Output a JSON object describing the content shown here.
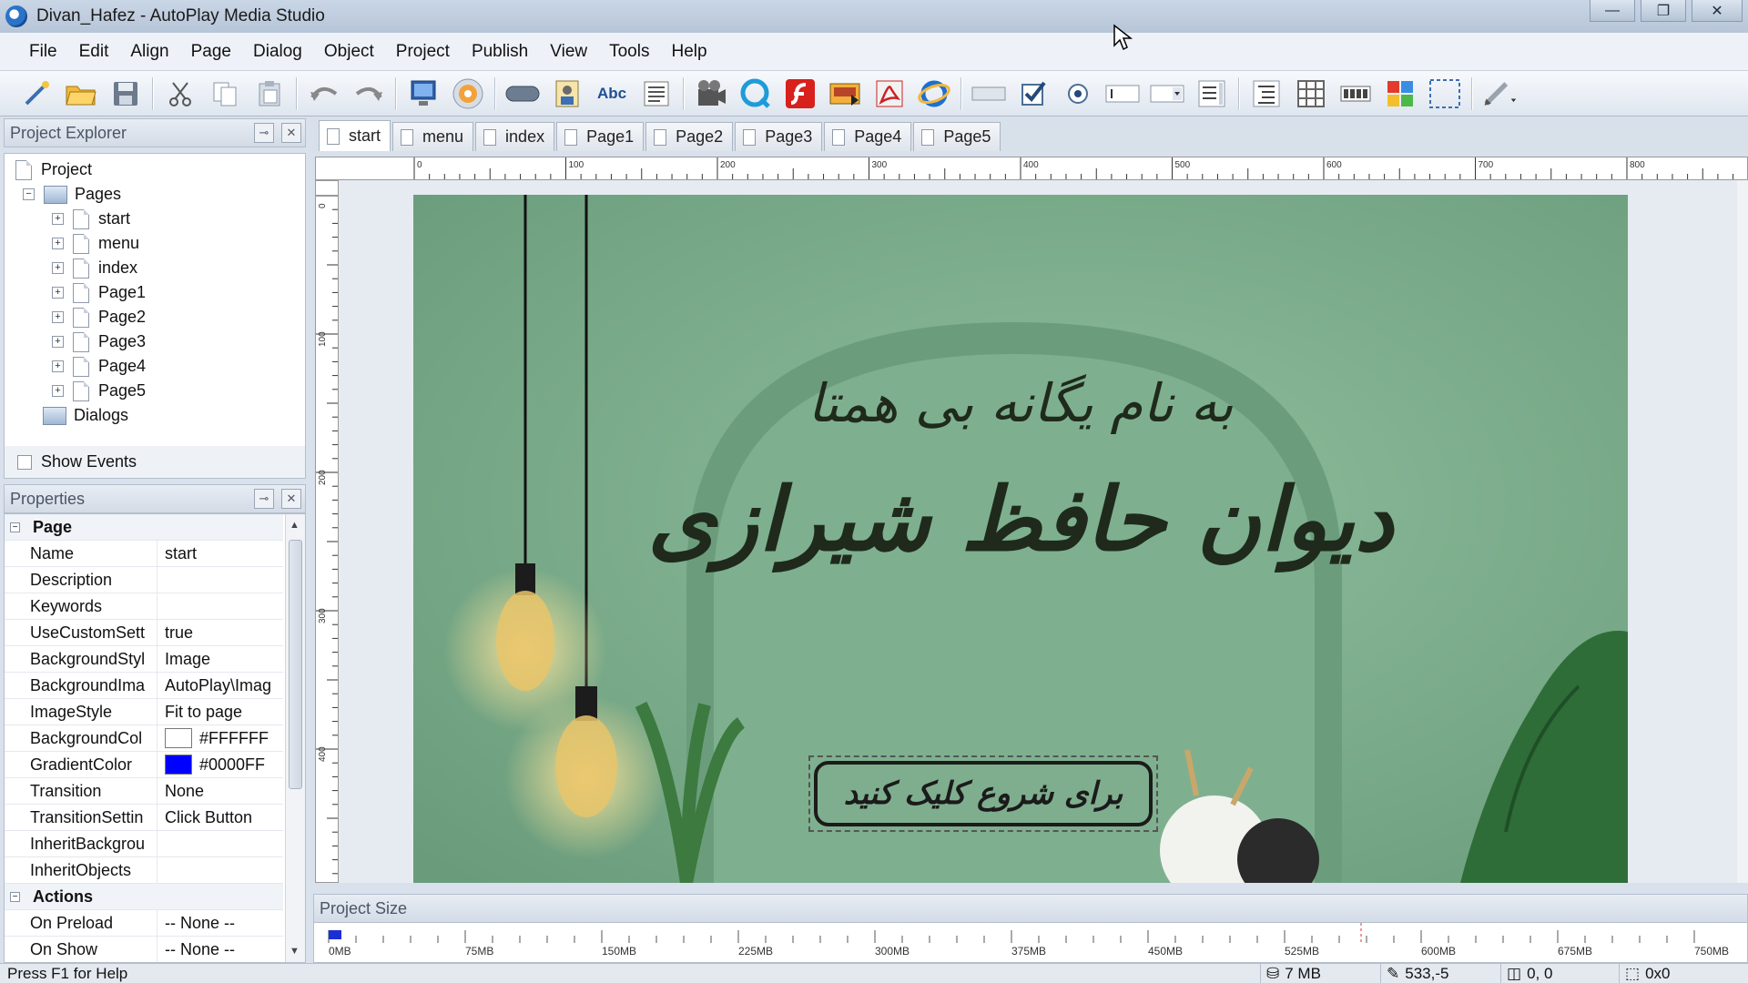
{
  "window": {
    "title": "Divan_Hafez - AutoPlay Media Studio"
  },
  "menu": [
    "File",
    "Edit",
    "Align",
    "Page",
    "Dialog",
    "Object",
    "Project",
    "Publish",
    "View",
    "Tools",
    "Help"
  ],
  "toolbar_icons": [
    "wand-icon",
    "open-folder-icon",
    "save-icon",
    "cut-icon",
    "copy-icon",
    "paste-icon",
    "undo-icon",
    "redo-icon",
    "preview-icon",
    "publish-disc-icon",
    "button-object-icon",
    "image-object-icon",
    "label-object-icon",
    "paragraph-object-icon",
    "video-object-icon",
    "quicktime-object-icon",
    "flash-object-icon",
    "slideshow-object-icon",
    "pdf-object-icon",
    "web-object-icon",
    "input-object-icon",
    "checkbox-object-icon",
    "radio-object-icon",
    "input-field-icon",
    "combobox-icon",
    "listbox-icon",
    "tree-icon",
    "grid-icon",
    "progress-icon",
    "plugin-icon",
    "hotspot-icon",
    "pencil-icon"
  ],
  "explorer": {
    "title": "Project Explorer",
    "root": "Project",
    "pages_label": "Pages",
    "pages": [
      "start",
      "menu",
      "index",
      "Page1",
      "Page2",
      "Page3",
      "Page4",
      "Page5"
    ],
    "dialogs_label": "Dialogs",
    "show_events": "Show Events"
  },
  "properties": {
    "title": "Properties",
    "page_category": "Page",
    "rows": [
      {
        "key": "Name",
        "value": "start"
      },
      {
        "key": "Description",
        "value": ""
      },
      {
        "key": "Keywords",
        "value": ""
      },
      {
        "key": "UseCustomSett",
        "value": "true"
      },
      {
        "key": "BackgroundStyl",
        "value": "Image"
      },
      {
        "key": "BackgroundIma",
        "value": "AutoPlay\\Imag"
      },
      {
        "key": "ImageStyle",
        "value": "Fit to page"
      },
      {
        "key": "BackgroundCol",
        "value": "#FFFFFF",
        "swatch": "#FFFFFF"
      },
      {
        "key": "GradientColor",
        "value": "#0000FF",
        "swatch": "#0000FF"
      },
      {
        "key": "Transition",
        "value": "None"
      },
      {
        "key": "TransitionSettin",
        "value": "Click Button"
      },
      {
        "key": "InheritBackgrou",
        "value": ""
      },
      {
        "key": "InheritObjects",
        "value": ""
      }
    ],
    "actions_category": "Actions",
    "actions": [
      {
        "key": "On Preload",
        "value": "-- None --"
      },
      {
        "key": "On Show",
        "value": "-- None --"
      }
    ]
  },
  "page_tabs": [
    "start",
    "menu",
    "index",
    "Page1",
    "Page2",
    "Page3",
    "Page4",
    "Page5"
  ],
  "active_tab": "start",
  "ruler_h_labels": [
    "0",
    "100",
    "200",
    "300",
    "400",
    "500",
    "600",
    "700",
    "800"
  ],
  "ruler_v_labels": [
    "0",
    "100",
    "200",
    "300",
    "400"
  ],
  "canvas": {
    "line1": "به نام یگانه بی همتا",
    "line2": "دیوان حافظ شیرازی",
    "button_text": "برای شروع کلیک کنید",
    "colors": {
      "wall": "#7fae8e",
      "arch": "#6d9e7e",
      "text": "#1f2a1c"
    }
  },
  "project_size": {
    "title": "Project Size",
    "labels": [
      "0MB",
      "75MB",
      "150MB",
      "225MB",
      "300MB",
      "375MB",
      "450MB",
      "525MB",
      "600MB",
      "675MB",
      "750MB"
    ],
    "used_mb": 7
  },
  "status": {
    "help": "Press F1 for Help",
    "size": "7 MB",
    "cursor_pos": "533,-5",
    "object_pos": "0, 0",
    "object_size": "0x0"
  }
}
